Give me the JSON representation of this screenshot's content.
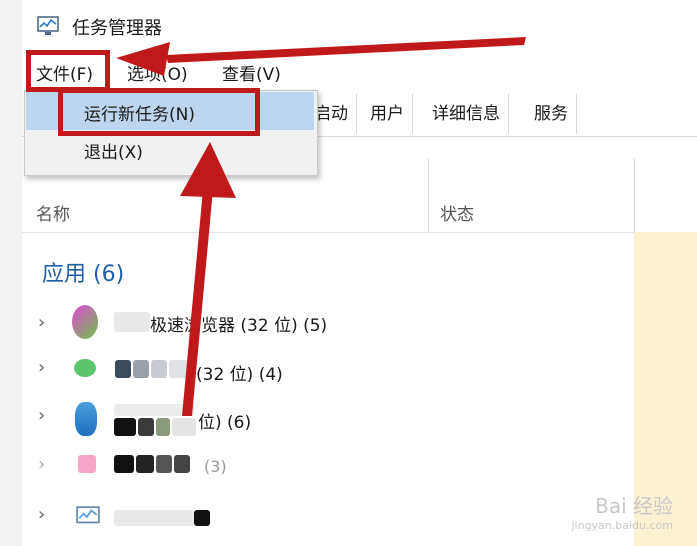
{
  "window": {
    "title": "任务管理器"
  },
  "menu": {
    "file": "文件(F)",
    "options": "选项(O)",
    "view": "查看(V)"
  },
  "file_menu": {
    "items": [
      "运行新任务(N)",
      "退出(X)"
    ]
  },
  "tabs": [
    "启动",
    "用户",
    "详细信息",
    "服务"
  ],
  "columns": {
    "name": "名称",
    "status": "状态"
  },
  "group": {
    "title": "应用 (6)"
  },
  "processes": [
    {
      "label": "极速浏览器 (32 位) (5)"
    },
    {
      "label": "(32 位) (4)"
    },
    {
      "label": "位) (6)"
    },
    {
      "label": "(3)"
    },
    {
      "label": ""
    }
  ],
  "watermark": {
    "brand": "Bai 经验",
    "url": "jingyan.baidu.com"
  },
  "colors": {
    "annotation_red": "#c0191c",
    "highlight": "#bcd6ef",
    "group_blue": "#1f5fa8"
  }
}
